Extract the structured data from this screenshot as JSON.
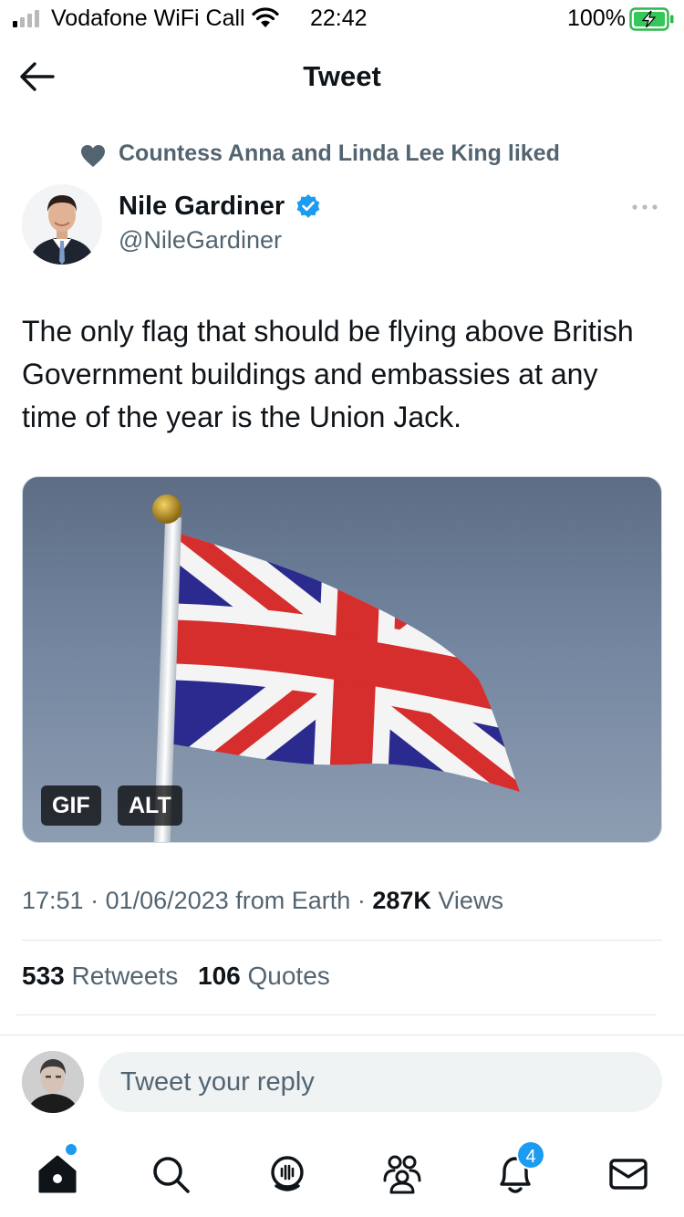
{
  "status_bar": {
    "carrier": "Vodafone WiFi Call",
    "time": "22:42",
    "battery": "100%"
  },
  "header": {
    "title": "Tweet"
  },
  "social_context": {
    "text": "Countess Anna and Linda Lee King liked"
  },
  "tweet": {
    "author_name": "Nile Gardiner",
    "author_handle": "@NileGardiner",
    "text": "The only flag that should be flying above British Government buildings and embassies at any time of the year is the Union Jack.",
    "media": {
      "gif_label": "GIF",
      "alt_label": "ALT"
    },
    "time": "17:51",
    "separator": "·",
    "date": "01/06/2023",
    "source": "from Earth",
    "views_count": "287K",
    "views_label": "Views",
    "retweets_count": "533",
    "retweets_label": "Retweets",
    "quotes_count": "106",
    "quotes_label": "Quotes"
  },
  "reply": {
    "placeholder": "Tweet your reply"
  },
  "tab_bar": {
    "notifications_count": "4"
  },
  "colors": {
    "accent": "#1d9bf0",
    "secondary_text": "#536471",
    "primary_text": "#0f1419"
  }
}
